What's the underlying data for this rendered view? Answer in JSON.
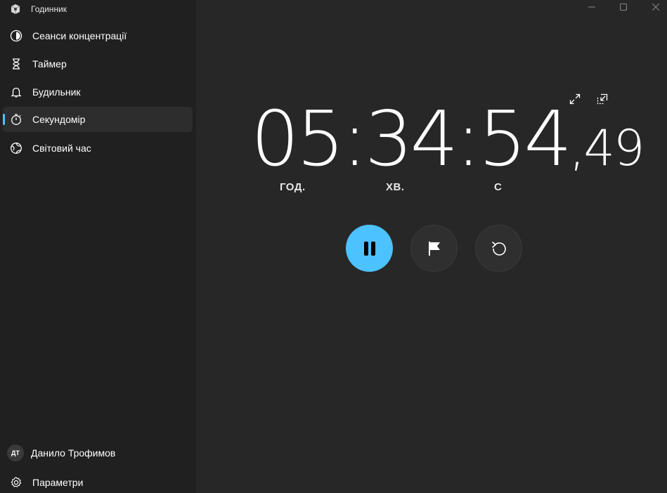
{
  "app": {
    "title": "Годинник"
  },
  "sidebar": {
    "items": [
      {
        "label": "Сеанси концентрації",
        "icon": "focus-sessions-icon",
        "active": false
      },
      {
        "label": "Таймер",
        "icon": "hourglass-icon",
        "active": false
      },
      {
        "label": "Будильник",
        "icon": "bell-icon",
        "active": false
      },
      {
        "label": "Секундомір",
        "icon": "stopwatch-icon",
        "active": true
      },
      {
        "label": "Світовий час",
        "icon": "globe-icon",
        "active": false
      }
    ],
    "user": {
      "initials": "ДТ",
      "name": "Данило Трофимов"
    },
    "settings_label": "Параметри"
  },
  "stopwatch": {
    "hours": "05",
    "minutes": "34",
    "seconds": "54",
    "fraction": ",49",
    "separator": ":",
    "labels": {
      "hours": "ГОД.",
      "minutes": "ХВ.",
      "seconds": "С"
    }
  },
  "colors": {
    "accent": "#4cc2ff",
    "sidebar_bg": "#202020",
    "main_bg": "#272727"
  }
}
